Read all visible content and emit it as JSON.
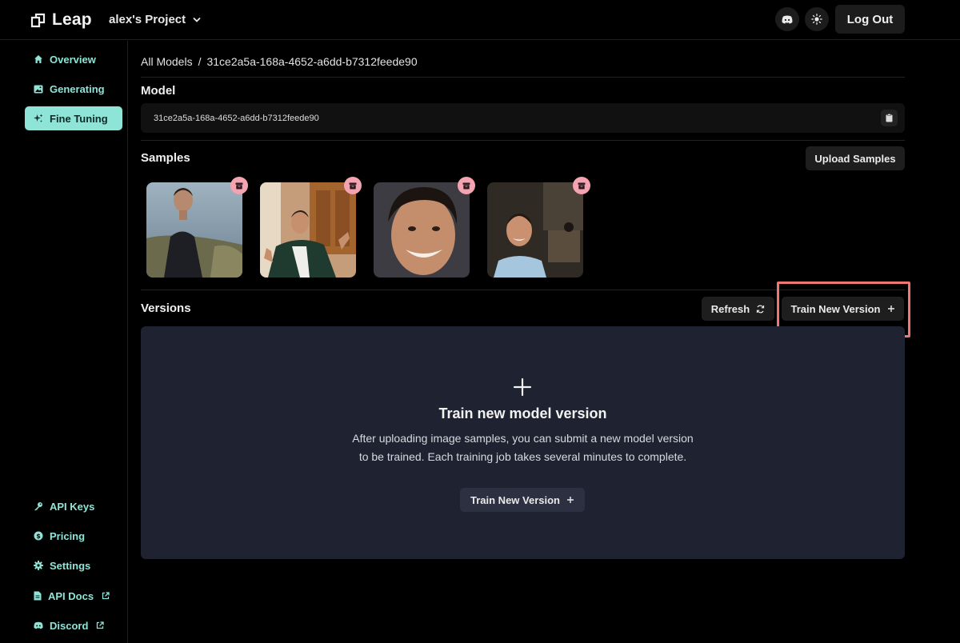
{
  "header": {
    "logo_text": "Leap",
    "project_name": "alex's Project",
    "logout_label": "Log Out",
    "icons": {
      "discord": "discord-icon",
      "theme": "sun-icon"
    }
  },
  "sidebar": {
    "items": [
      {
        "label": "Overview",
        "icon": "home-icon",
        "active": false
      },
      {
        "label": "Generating",
        "icon": "image-icon",
        "active": false
      },
      {
        "label": "Fine Tuning",
        "icon": "sparkle-icon",
        "active": true
      }
    ],
    "bottom_items": [
      {
        "label": "API Keys",
        "icon": "key-icon"
      },
      {
        "label": "Pricing",
        "icon": "dollar-icon"
      },
      {
        "label": "Settings",
        "icon": "gear-icon"
      },
      {
        "label": "API Docs",
        "icon": "document-icon",
        "external": true
      },
      {
        "label": "Discord",
        "icon": "discord-icon",
        "external": true
      }
    ]
  },
  "breadcrumb": {
    "root": "All Models",
    "separator": "/",
    "current": "31ce2a5a-168a-4652-a6dd-b7312feede90"
  },
  "model": {
    "title": "Model",
    "id": "31ce2a5a-168a-4652-a6dd-b7312feede90"
  },
  "samples": {
    "title": "Samples",
    "upload_label": "Upload Samples",
    "count": 4
  },
  "versions": {
    "title": "Versions",
    "refresh_label": "Refresh",
    "train_label": "Train New Version",
    "empty_title": "Train new model version",
    "empty_description": "After uploading image samples, you can submit a new model version to be trained. Each training job takes several minutes to complete.",
    "empty_button_label": "Train New Version"
  },
  "colors": {
    "accent": "#8ee4d6",
    "highlight": "#f07575",
    "delete_badge": "#f4a3b0",
    "panel": "#1f2230"
  }
}
